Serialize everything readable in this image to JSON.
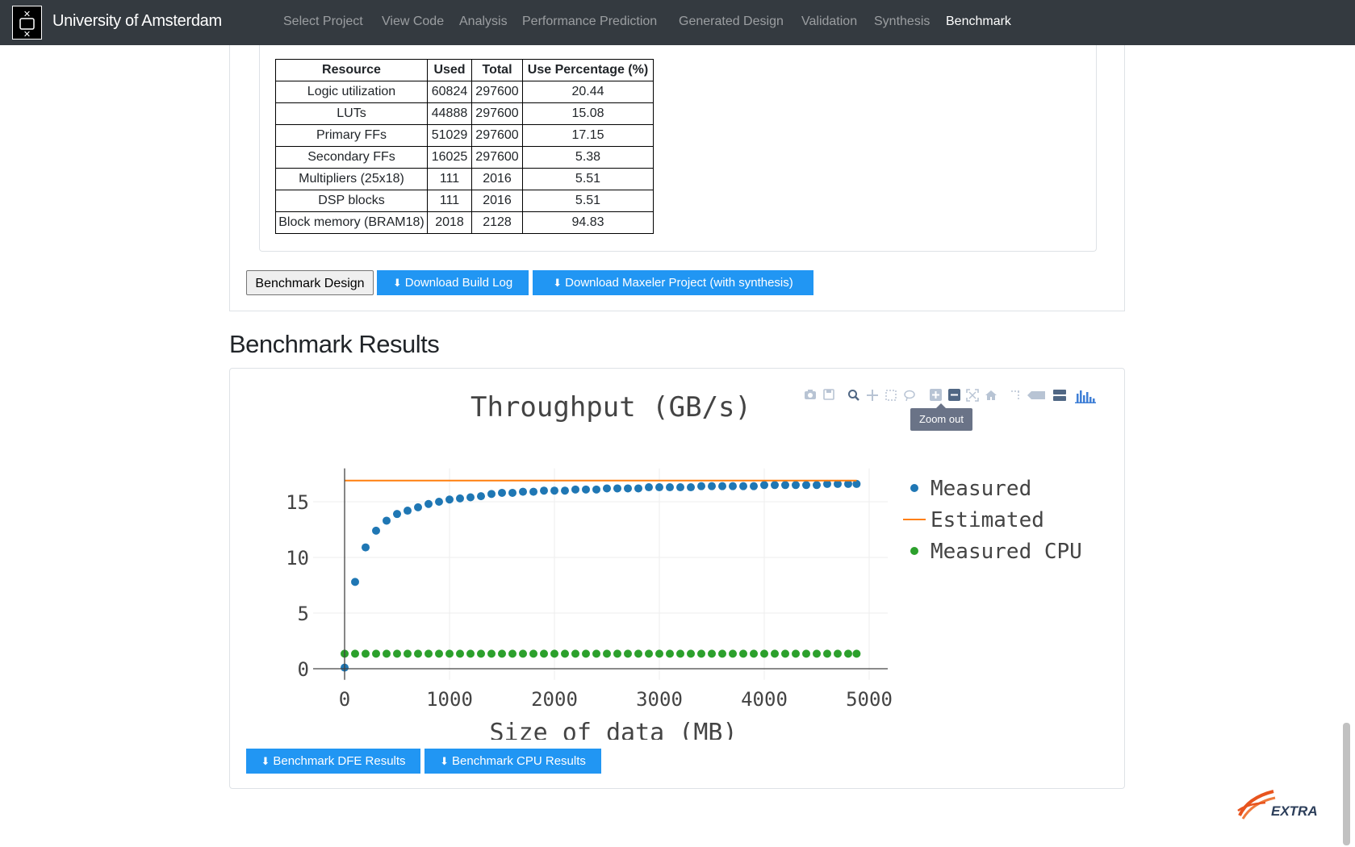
{
  "navbar": {
    "brand": "University of Amsterdam",
    "items": [
      "Select Project",
      "View Code",
      "Analysis",
      "Performance Prediction",
      "Generated Design",
      "Validation",
      "Synthesis",
      "Benchmark"
    ],
    "active": "Benchmark"
  },
  "resources": {
    "headers": [
      "Resource",
      "Used",
      "Total",
      "Use Percentage (%)"
    ],
    "rows": [
      [
        "Logic utilization",
        "60824",
        "297600",
        "20.44"
      ],
      [
        "LUTs",
        "44888",
        "297600",
        "15.08"
      ],
      [
        "Primary FFs",
        "51029",
        "297600",
        "17.15"
      ],
      [
        "Secondary FFs",
        "16025",
        "297600",
        "5.38"
      ],
      [
        "Multipliers (25x18)",
        "111",
        "2016",
        "5.51"
      ],
      [
        "DSP blocks",
        "111",
        "2016",
        "5.51"
      ],
      [
        "Block memory (BRAM18)",
        "2018",
        "2128",
        "94.83"
      ]
    ]
  },
  "buttons": {
    "benchmark_design": "Benchmark Design",
    "download_build_log": "Download Build Log",
    "download_maxeler": "Download Maxeler Project (with synthesis)",
    "benchmark_dfe": "Benchmark DFE Results",
    "benchmark_cpu": "Benchmark CPU Results",
    "download_icon": "download-icon"
  },
  "results_heading": "Benchmark Results",
  "tooltip": "Zoom out",
  "modebar_icons": [
    "camera-icon",
    "save-icon",
    "zoom-icon",
    "pan-icon",
    "box-select-icon",
    "lasso-icon",
    "zoom-in-icon",
    "zoom-out-icon",
    "autoscale-icon",
    "reset-axes-icon",
    "toggle-spikelines-icon",
    "hover-closest-icon",
    "hover-compare-icon",
    "plotly-logo-icon"
  ],
  "footer_logo": "EXTRA",
  "colors": {
    "navbar": "#343a40",
    "button": "#2196f3",
    "measured": "#1f77b4",
    "estimated": "#ff7f0e",
    "cpu": "#2ca02c"
  },
  "chart_data": {
    "type": "scatter",
    "title": "Throughput (GB/s)",
    "xlabel": "Size of data (MB)",
    "ylabel": "",
    "xlim": [
      -300,
      5050
    ],
    "ylim": [
      -1,
      18
    ],
    "xticks": [
      0,
      1000,
      2000,
      3000,
      4000,
      5000
    ],
    "yticks": [
      0,
      5,
      10,
      15
    ],
    "grid": true,
    "legend_position": "right",
    "series": [
      {
        "name": "Measured",
        "mode": "markers",
        "color": "#1f77b4",
        "x": [
          0,
          100,
          200,
          300,
          400,
          500,
          600,
          700,
          800,
          900,
          1000,
          1100,
          1200,
          1300,
          1400,
          1500,
          1600,
          1700,
          1800,
          1900,
          2000,
          2100,
          2200,
          2300,
          2400,
          2500,
          2600,
          2700,
          2800,
          2900,
          3000,
          3100,
          3200,
          3300,
          3400,
          3500,
          3600,
          3700,
          3800,
          3900,
          4000,
          4100,
          4200,
          4300,
          4400,
          4500,
          4600,
          4700,
          4800,
          4880
        ],
        "y": [
          0.1,
          7.8,
          10.9,
          12.4,
          13.3,
          13.9,
          14.2,
          14.5,
          14.8,
          15.0,
          15.2,
          15.3,
          15.4,
          15.5,
          15.7,
          15.8,
          15.8,
          15.9,
          15.9,
          16.0,
          16.0,
          16.0,
          16.1,
          16.1,
          16.1,
          16.2,
          16.2,
          16.2,
          16.2,
          16.3,
          16.3,
          16.3,
          16.3,
          16.3,
          16.4,
          16.4,
          16.4,
          16.4,
          16.4,
          16.4,
          16.5,
          16.5,
          16.5,
          16.5,
          16.5,
          16.5,
          16.6,
          16.6,
          16.6,
          16.6
        ]
      },
      {
        "name": "Estimated",
        "mode": "lines",
        "color": "#ff7f0e",
        "x": [
          0,
          4880
        ],
        "y": [
          16.9,
          16.9
        ]
      },
      {
        "name": "Measured CPU",
        "mode": "markers",
        "color": "#2ca02c",
        "x": [
          0,
          100,
          200,
          300,
          400,
          500,
          600,
          700,
          800,
          900,
          1000,
          1100,
          1200,
          1300,
          1400,
          1500,
          1600,
          1700,
          1800,
          1900,
          2000,
          2100,
          2200,
          2300,
          2400,
          2500,
          2600,
          2700,
          2800,
          2900,
          3000,
          3100,
          3200,
          3300,
          3400,
          3500,
          3600,
          3700,
          3800,
          3900,
          4000,
          4100,
          4200,
          4300,
          4400,
          4500,
          4600,
          4700,
          4800,
          4880
        ],
        "y": [
          1.35,
          1.35,
          1.35,
          1.35,
          1.35,
          1.35,
          1.35,
          1.35,
          1.35,
          1.35,
          1.35,
          1.35,
          1.35,
          1.35,
          1.35,
          1.35,
          1.35,
          1.35,
          1.35,
          1.35,
          1.35,
          1.35,
          1.35,
          1.35,
          1.35,
          1.35,
          1.35,
          1.35,
          1.35,
          1.35,
          1.35,
          1.35,
          1.35,
          1.35,
          1.35,
          1.35,
          1.35,
          1.35,
          1.35,
          1.35,
          1.35,
          1.35,
          1.35,
          1.35,
          1.35,
          1.35,
          1.35,
          1.35,
          1.35,
          1.35
        ]
      }
    ]
  }
}
